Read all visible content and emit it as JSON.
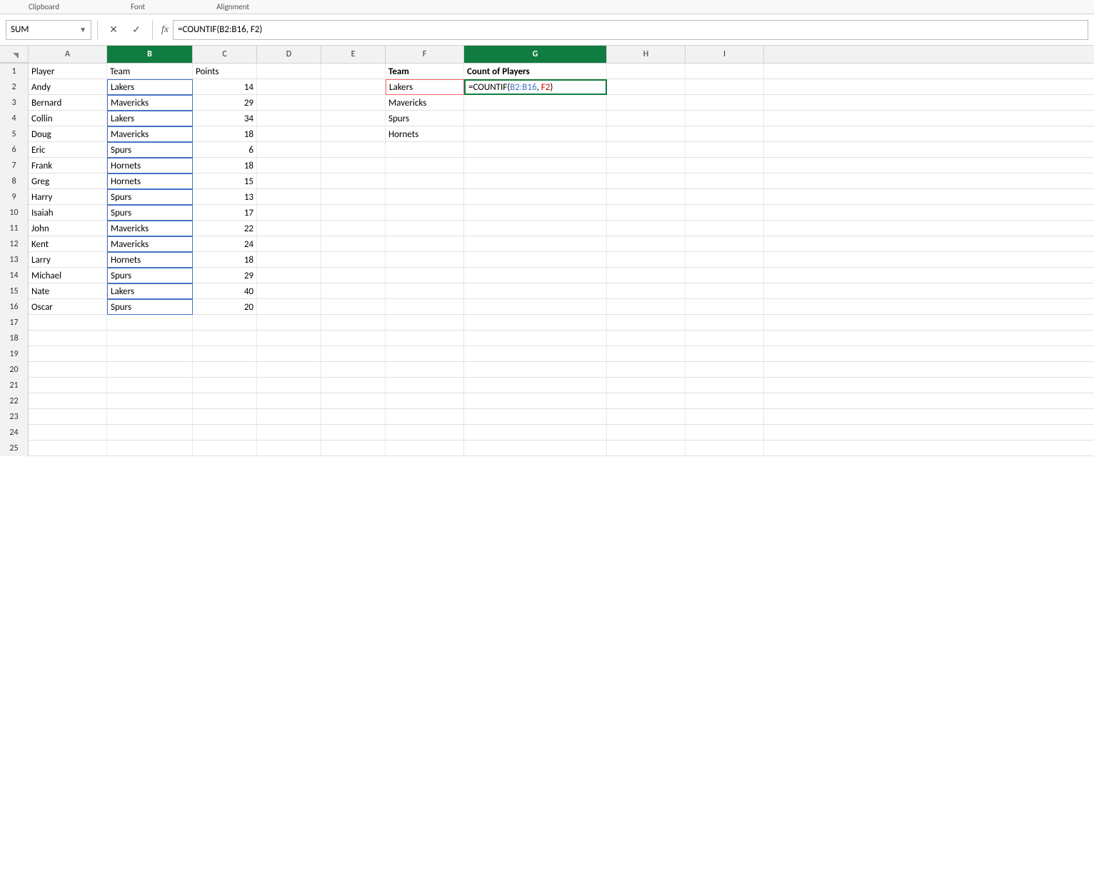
{
  "ribbon": {
    "sections": [
      "Clipboard",
      "Font",
      "Alignment"
    ]
  },
  "formula_bar": {
    "name_box": "SUM",
    "cancel_label": "✕",
    "confirm_label": "✓",
    "fx_label": "fx",
    "formula": "=COUNTIF(B2:B16, F2)"
  },
  "columns": {
    "headers": [
      "A",
      "B",
      "C",
      "D",
      "E",
      "F",
      "G",
      "H",
      "I"
    ]
  },
  "rows": [
    {
      "row": 1,
      "a": "Player",
      "b": "Team",
      "c": "Points",
      "d": "",
      "e": "",
      "f": "Team",
      "g": "Count of Players",
      "h": "",
      "i": ""
    },
    {
      "row": 2,
      "a": "Andy",
      "b": "Lakers",
      "c": "14",
      "d": "",
      "e": "",
      "f": "Lakers",
      "g": "=COUNTIF(B2:B16, F2)",
      "h": "",
      "i": ""
    },
    {
      "row": 3,
      "a": "Bernard",
      "b": "Mavericks",
      "c": "29",
      "d": "",
      "e": "",
      "f": "Mavericks",
      "g": "",
      "h": "",
      "i": ""
    },
    {
      "row": 4,
      "a": "Collin",
      "b": "Lakers",
      "c": "34",
      "d": "",
      "e": "",
      "f": "Spurs",
      "g": "",
      "h": "",
      "i": ""
    },
    {
      "row": 5,
      "a": "Doug",
      "b": "Mavericks",
      "c": "18",
      "d": "",
      "e": "",
      "f": "Hornets",
      "g": "",
      "h": "",
      "i": ""
    },
    {
      "row": 6,
      "a": "Eric",
      "b": "Spurs",
      "c": "6",
      "d": "",
      "e": "",
      "f": "",
      "g": "",
      "h": "",
      "i": ""
    },
    {
      "row": 7,
      "a": "Frank",
      "b": "Hornets",
      "c": "18",
      "d": "",
      "e": "",
      "f": "",
      "g": "",
      "h": "",
      "i": ""
    },
    {
      "row": 8,
      "a": "Greg",
      "b": "Hornets",
      "c": "15",
      "d": "",
      "e": "",
      "f": "",
      "g": "",
      "h": "",
      "i": ""
    },
    {
      "row": 9,
      "a": "Harry",
      "b": "Spurs",
      "c": "13",
      "d": "",
      "e": "",
      "f": "",
      "g": "",
      "h": "",
      "i": ""
    },
    {
      "row": 10,
      "a": "Isaiah",
      "b": "Spurs",
      "c": "17",
      "d": "",
      "e": "",
      "f": "",
      "g": "",
      "h": "",
      "i": ""
    },
    {
      "row": 11,
      "a": "John",
      "b": "Mavericks",
      "c": "22",
      "d": "",
      "e": "",
      "f": "",
      "g": "",
      "h": "",
      "i": ""
    },
    {
      "row": 12,
      "a": "Kent",
      "b": "Mavericks",
      "c": "24",
      "d": "",
      "e": "",
      "f": "",
      "g": "",
      "h": "",
      "i": ""
    },
    {
      "row": 13,
      "a": "Larry",
      "b": "Hornets",
      "c": "18",
      "d": "",
      "e": "",
      "f": "",
      "g": "",
      "h": "",
      "i": ""
    },
    {
      "row": 14,
      "a": "Michael",
      "b": "Spurs",
      "c": "29",
      "d": "",
      "e": "",
      "f": "",
      "g": "",
      "h": "",
      "i": ""
    },
    {
      "row": 15,
      "a": "Nate",
      "b": "Lakers",
      "c": "40",
      "d": "",
      "e": "",
      "f": "",
      "g": "",
      "h": "",
      "i": ""
    },
    {
      "row": 16,
      "a": "Oscar",
      "b": "Spurs",
      "c": "20",
      "d": "",
      "e": "",
      "f": "",
      "g": "",
      "h": "",
      "i": ""
    },
    {
      "row": 17,
      "a": "",
      "b": "",
      "c": "",
      "d": "",
      "e": "",
      "f": "",
      "g": "",
      "h": "",
      "i": ""
    },
    {
      "row": 18,
      "a": "",
      "b": "",
      "c": "",
      "d": "",
      "e": "",
      "f": "",
      "g": "",
      "h": "",
      "i": ""
    },
    {
      "row": 19,
      "a": "",
      "b": "",
      "c": "",
      "d": "",
      "e": "",
      "f": "",
      "g": "",
      "h": "",
      "i": ""
    },
    {
      "row": 20,
      "a": "",
      "b": "",
      "c": "",
      "d": "",
      "e": "",
      "f": "",
      "g": "",
      "h": "",
      "i": ""
    },
    {
      "row": 21,
      "a": "",
      "b": "",
      "c": "",
      "d": "",
      "e": "",
      "f": "",
      "g": "",
      "h": "",
      "i": ""
    },
    {
      "row": 22,
      "a": "",
      "b": "",
      "c": "",
      "d": "",
      "e": "",
      "f": "",
      "g": "",
      "h": "",
      "i": ""
    },
    {
      "row": 23,
      "a": "",
      "b": "",
      "c": "",
      "d": "",
      "e": "",
      "f": "",
      "g": "",
      "h": "",
      "i": ""
    },
    {
      "row": 24,
      "a": "",
      "b": "",
      "c": "",
      "d": "",
      "e": "",
      "f": "",
      "g": "",
      "h": "",
      "i": ""
    },
    {
      "row": 25,
      "a": "",
      "b": "",
      "c": "",
      "d": "",
      "e": "",
      "f": "",
      "g": "",
      "h": "",
      "i": ""
    }
  ]
}
